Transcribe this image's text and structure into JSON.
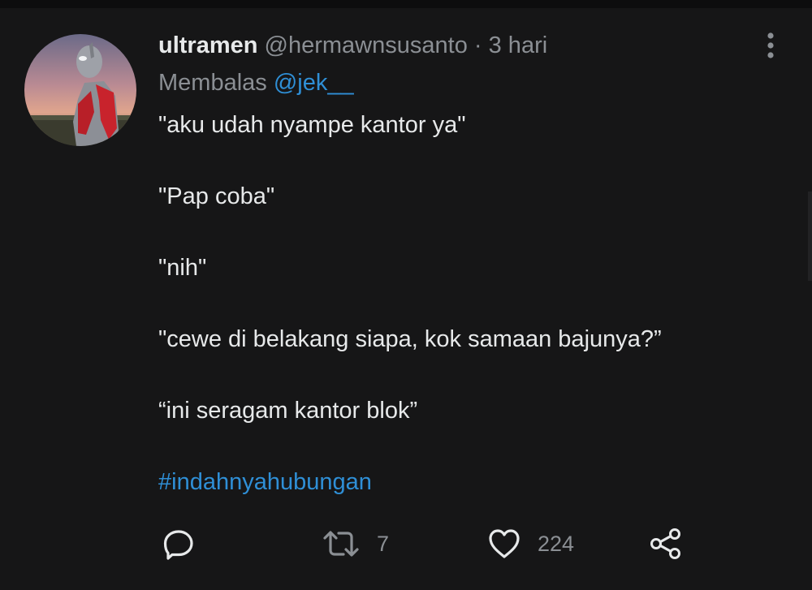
{
  "tweet": {
    "display_name": "ultramen",
    "handle": "@hermawnsusanto",
    "separator": "·",
    "time": "3 hari",
    "reply_prefix": "Membalas",
    "reply_mention": "@jek__",
    "lines": [
      "\"aku udah nyampe kantor ya\"",
      "\"Pap coba\"",
      "\"nih\"",
      "\"cewe di belakang siapa, kok samaan bajunya?”",
      "“ini seragam kantor blok”"
    ],
    "hashtag": "#indahnyahubungan"
  },
  "actions": {
    "reply_icon": "reply-icon",
    "retweet_icon": "retweet-icon",
    "retweet_count": "7",
    "like_icon": "heart-icon",
    "like_count": "224",
    "share_icon": "share-icon"
  },
  "colors": {
    "background": "#161617",
    "text": "#e7e9ea",
    "muted": "#8b8f94",
    "link": "#2f8fd6"
  }
}
